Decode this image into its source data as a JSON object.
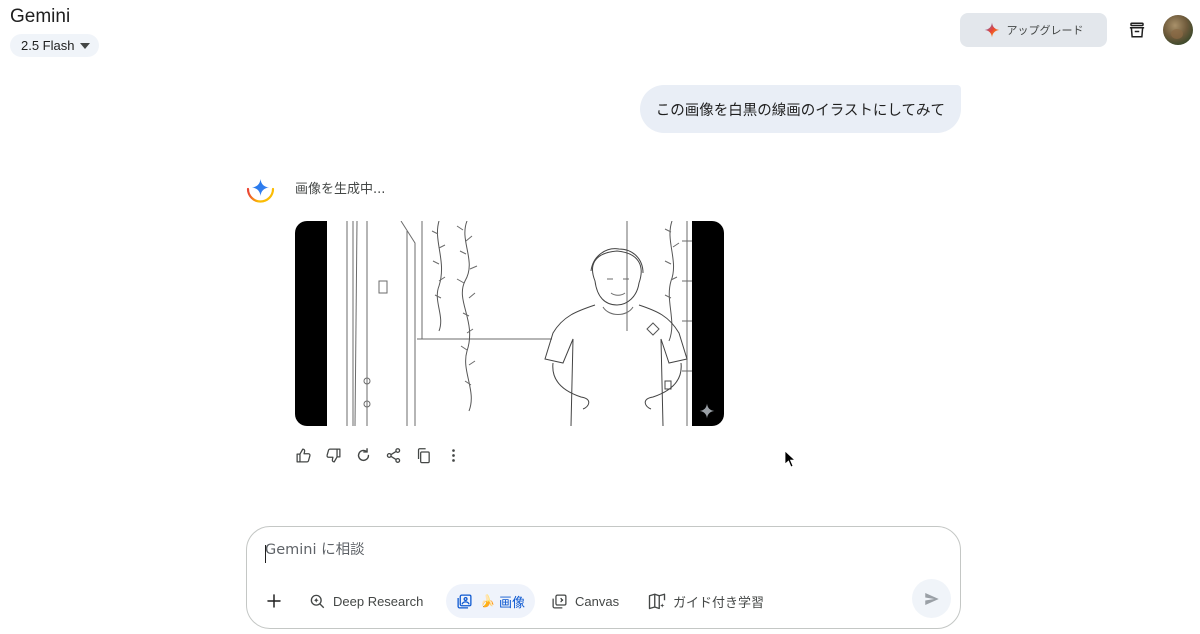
{
  "header": {
    "app_title": "Gemini",
    "model_label": "2.5 Flash",
    "upgrade_label": "アップグレード",
    "icons": [
      "sparkle-icon",
      "archive-icon",
      "avatar"
    ]
  },
  "conversation": {
    "user_message": "この画像を白黒の線画のイラストにしてみて",
    "assistant_status": "画像を生成中...",
    "generated_image_alt": "",
    "action_icons": [
      "thumb-up-icon",
      "thumb-down-icon",
      "redo-icon",
      "share-icon",
      "copy-icon",
      "more-vert-icon"
    ]
  },
  "composer": {
    "placeholder": "Gemini に相談",
    "tools": [
      {
        "label": "Deep Research",
        "icon": "deep-research-icon"
      },
      {
        "label": "画像",
        "emoji": "🍌",
        "icon": "image-tool-icon",
        "active": true
      },
      {
        "label": "Canvas",
        "icon": "canvas-icon"
      },
      {
        "label": "ガイド付き学習",
        "icon": "guided-learning-icon"
      }
    ]
  },
  "colors": {
    "accent": "#0b57d0",
    "bubble": "#e9eef6",
    "chip": "#f0f4f9",
    "upgrade_bg": "#e3e7ec",
    "text": "#1f1f1f"
  }
}
